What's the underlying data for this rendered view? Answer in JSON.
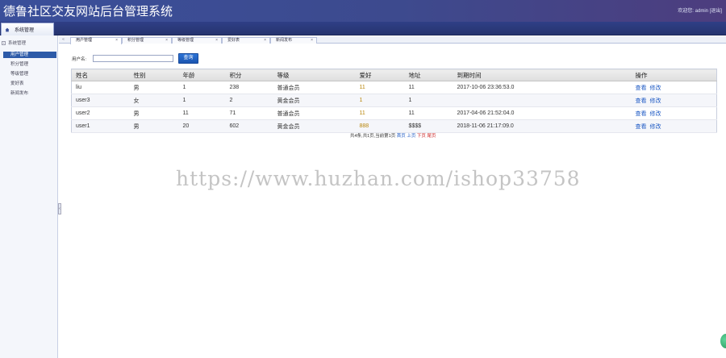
{
  "header": {
    "title": "德鲁社区交友网站后台管理系统",
    "welcome_prefix": "欢迎您:",
    "username": "admin",
    "logout": "[退出]"
  },
  "navbar": {
    "tab_label": "系统管理",
    "icon": "home-icon"
  },
  "sidebar": {
    "group_label": "系统管理",
    "items": [
      {
        "label": "用户管理",
        "active": true
      },
      {
        "label": "积分管理",
        "active": false
      },
      {
        "label": "等级管理",
        "active": false
      },
      {
        "label": "爱好表",
        "active": false
      },
      {
        "label": "新闻发布",
        "active": false
      }
    ]
  },
  "tabs": [
    {
      "label": "用户管理",
      "active": true
    },
    {
      "label": "积分管理",
      "active": false
    },
    {
      "label": "等级管理",
      "active": false
    },
    {
      "label": "爱好表",
      "active": false
    },
    {
      "label": "新闻发布",
      "active": false
    }
  ],
  "tab_close": "×",
  "search": {
    "label": "用户名:",
    "value": "",
    "button": "查询"
  },
  "table": {
    "columns": [
      "姓名",
      "性别",
      "年龄",
      "积分",
      "等级",
      "爱好",
      "地址",
      "到期时间",
      "操作"
    ],
    "rows": [
      [
        "liu",
        "男",
        "1",
        "238",
        "普通会员",
        "11",
        "11",
        "2017-10-06 23:36:53.0"
      ],
      [
        "user3",
        "女",
        "1",
        "2",
        "黄金会员",
        "1",
        "1",
        ""
      ],
      [
        "user2",
        "男",
        "11",
        "71",
        "普通会员",
        "11",
        "11",
        "2017-04-06 21:52:04.0"
      ],
      [
        "user1",
        "男",
        "20",
        "602",
        "黄金会员",
        "888",
        "$$$$",
        "2018-11-06 21:17:09.0"
      ]
    ],
    "action_view": "查看",
    "action_edit": "修改"
  },
  "pager": {
    "text": "共4条,共1页,当前第1页",
    "first": "首页",
    "prev": "上页",
    "next": "下页",
    "last": "尾页"
  },
  "watermark": "https://www.huzhan.com/ishop33758"
}
